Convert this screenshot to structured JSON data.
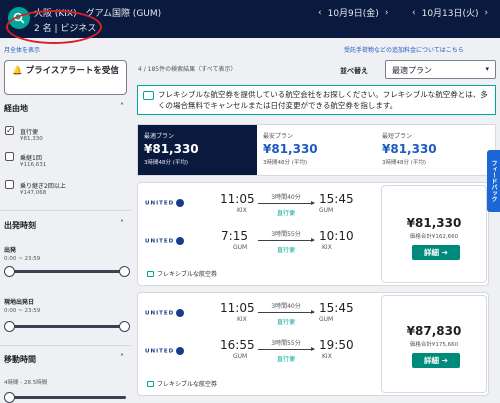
{
  "header": {
    "route": "大阪 (KIX) - グアム国際 (GUM)",
    "passengers": "2 名 | ビジネス",
    "depart_date": "10月9日(金)",
    "return_date": "10月13日(火)"
  },
  "links": {
    "show_total_price": "月全体を表示",
    "baggage_fees": "受託手荷物などの追加料金についてはこちら"
  },
  "sidebar": {
    "price_alert": "プライスアラートを受信",
    "stops_title": "経由地",
    "stops": [
      {
        "label": "直行便",
        "price": "¥81,330",
        "checked": true
      },
      {
        "label": "乗継1回",
        "price": "¥116,631",
        "checked": false
      },
      {
        "label": "乗り継ぎ2回以上",
        "price": "¥147,068",
        "checked": false
      }
    ],
    "departure_title": "出発時刻",
    "departure_label": "出発",
    "departure_range": "0:00 ~ 23:59",
    "return_label": "現地出発日",
    "return_range": "0:00 ~ 23:59",
    "duration_title": "移動時間",
    "duration_range": "4時間 - 28.5時間"
  },
  "results": {
    "count_text": "4 / 185件の検索結果（すべて表示）",
    "sort_label": "並べ替え",
    "sort_value": "最適プラン",
    "info_text": "フレキシブルな航空券を提供している航空会社をお探しください。フレキシブルな航空券とは、多くの場合無料でキャンセルまたは日付変更ができる航空券を指します。",
    "tabs": [
      {
        "name": "最適プラン",
        "price": "¥81,330",
        "duration": "3時間48分 (平均)"
      },
      {
        "name": "最安プラン",
        "price": "¥81,330",
        "duration": "3時間48分 (平均)"
      },
      {
        "name": "最短プラン",
        "price": "¥81,330",
        "duration": "3時間48分 (平均)"
      }
    ],
    "cards": [
      {
        "legs": [
          {
            "airline": "UNITED",
            "dep_time": "11:05",
            "dep_code": "KIX",
            "arr_time": "15:45",
            "arr_code": "GUM",
            "duration": "3時間40分",
            "stops": "直行便"
          },
          {
            "airline": "UNITED",
            "dep_time": "7:15",
            "dep_code": "GUM",
            "arr_time": "10:10",
            "arr_code": "KIX",
            "duration": "3時間55分",
            "stops": "直行便"
          }
        ],
        "flex_note": "フレキシブルな航空券",
        "price": "¥81,330",
        "price_total": "価格合計¥162,660",
        "detail_label": "詳細 ➔"
      },
      {
        "legs": [
          {
            "airline": "UNITED",
            "dep_time": "11:05",
            "dep_code": "KIX",
            "arr_time": "15:45",
            "arr_code": "GUM",
            "duration": "3時間40分",
            "stops": "直行便"
          },
          {
            "airline": "UNITED",
            "dep_time": "16:55",
            "dep_code": "GUM",
            "arr_time": "19:50",
            "arr_code": "KIX",
            "duration": "3時間55分",
            "stops": "直行便"
          }
        ],
        "flex_note": "フレキシブルな航空券",
        "price": "¥87,830",
        "price_total": "価格合計¥175,660",
        "detail_label": "詳細 ➔"
      }
    ]
  },
  "feedback_label": "フィードバック",
  "colors": {
    "navy": "#0a1a3f",
    "teal": "#00a698",
    "blue": "#1d5bbf",
    "annotation_red": "#d92027"
  }
}
